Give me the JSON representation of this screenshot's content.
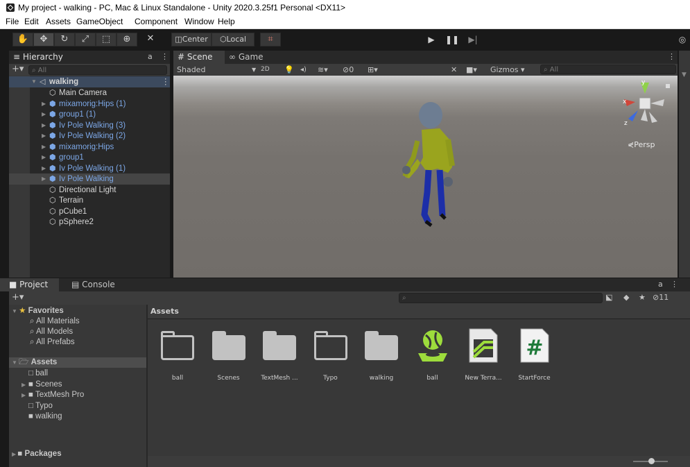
{
  "window": {
    "title": "My project - walking - PC, Mac & Linux Standalone - Unity 2020.3.25f1 Personal <DX11>"
  },
  "menu": [
    "File",
    "Edit",
    "Assets",
    "GameObject",
    "Component",
    "Window",
    "Help"
  ],
  "toolbar": {
    "center_label": "Center",
    "local_label": "Local"
  },
  "hierarchy": {
    "tab": "Hierarchy",
    "search_placeholder": "All",
    "scene_name": "walking",
    "items": [
      {
        "label": "Main Camera",
        "color": "white",
        "expandable": false
      },
      {
        "label": "mixamorig:Hips (1)",
        "color": "blue",
        "expandable": true
      },
      {
        "label": "group1 (1)",
        "color": "blue",
        "expandable": true
      },
      {
        "label": "Iv Pole Walking (3)",
        "color": "blue",
        "expandable": true
      },
      {
        "label": "Iv Pole Walking (2)",
        "color": "blue",
        "expandable": true
      },
      {
        "label": "mixamorig:Hips",
        "color": "blue",
        "expandable": true
      },
      {
        "label": "group1",
        "color": "blue",
        "expandable": true
      },
      {
        "label": "Iv Pole Walking (1)",
        "color": "blue",
        "expandable": true
      },
      {
        "label": "Iv Pole Walking",
        "color": "blue",
        "expandable": true,
        "selected": true
      },
      {
        "label": "Directional Light",
        "color": "white",
        "expandable": false
      },
      {
        "label": "Terrain",
        "color": "white",
        "expandable": false
      },
      {
        "label": "pCube1",
        "color": "white",
        "expandable": false
      },
      {
        "label": "pSphere2",
        "color": "white",
        "expandable": false
      }
    ]
  },
  "scene": {
    "tabs": [
      "Scene",
      "Game"
    ],
    "shading": "Shaded",
    "mode_2d": "2D",
    "hidden_count": "0",
    "gizmos_label": "Gizmos",
    "search_placeholder": "All",
    "persp_label": "Persp",
    "axis_labels": {
      "x": "x",
      "y": "y",
      "z": "z"
    }
  },
  "project": {
    "tabs": [
      "Project",
      "Console"
    ],
    "hidden_count": "11",
    "favorites_label": "Favorites",
    "favorites": [
      "All Materials",
      "All Models",
      "All Prefabs"
    ],
    "assets_label": "Assets",
    "asset_tree": [
      {
        "label": "ball",
        "icon": "folder-outline",
        "expandable": false
      },
      {
        "label": "Scenes",
        "icon": "folder",
        "expandable": true
      },
      {
        "label": "TextMesh Pro",
        "icon": "folder",
        "expandable": true
      },
      {
        "label": "Typo",
        "icon": "folder-outline",
        "expandable": false
      },
      {
        "label": "walking",
        "icon": "folder",
        "expandable": false
      }
    ],
    "packages_label": "Packages",
    "breadcrumb": "Assets",
    "grid": [
      {
        "label": "ball",
        "type": "folder-outline"
      },
      {
        "label": "Scenes",
        "type": "folder"
      },
      {
        "label": "TextMesh ...",
        "type": "folder"
      },
      {
        "label": "Typo",
        "type": "folder-outline"
      },
      {
        "label": "walking",
        "type": "folder"
      },
      {
        "label": "ball",
        "type": "terrain-layer"
      },
      {
        "label": "New Terra...",
        "type": "terrain-data"
      },
      {
        "label": "StartForce",
        "type": "csharp-script"
      }
    ]
  },
  "colors": {
    "accent_blue": "#7ca7e6",
    "terrain_green": "#9ddc3c",
    "script_green": "#1f7a3a"
  }
}
